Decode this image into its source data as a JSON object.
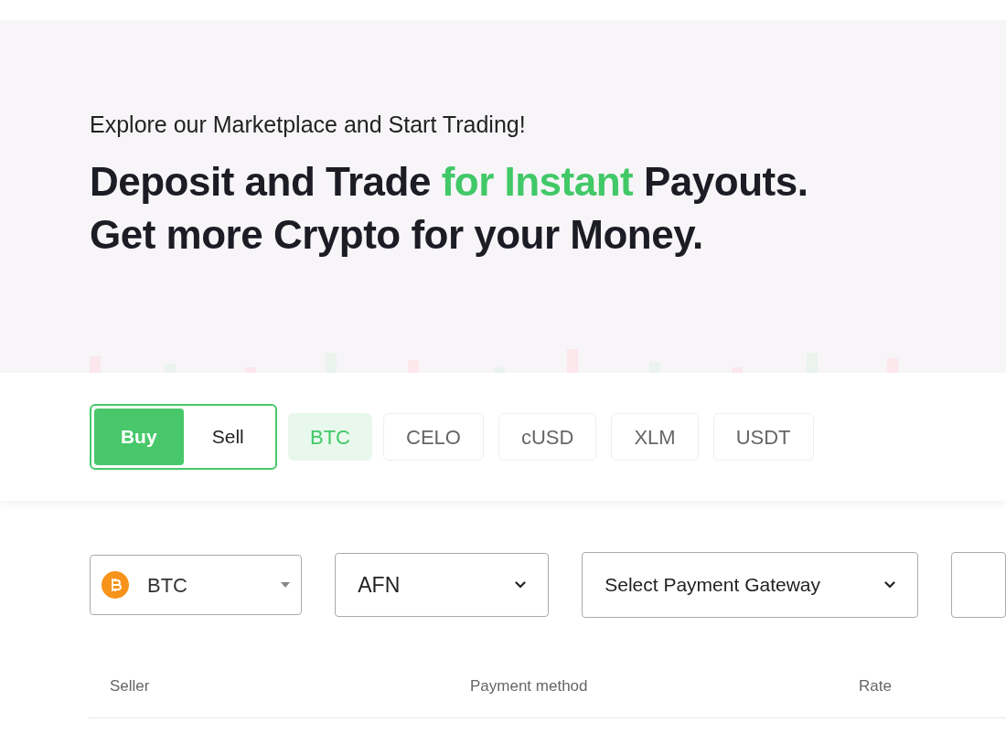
{
  "hero": {
    "eyebrow": "Explore our Marketplace and Start Trading!",
    "headline": "Deposit and Trade ",
    "headline_accent": "for Instant",
    "headline_rest": " Payouts.",
    "subheadline": "Get more Crypto for your Money."
  },
  "trade_toggle": [
    {
      "label": "Buy",
      "selected": true
    },
    {
      "label": "Sell",
      "selected": false
    }
  ],
  "coins": [
    {
      "label": "BTC",
      "selected": true
    },
    {
      "label": "CELO",
      "selected": false
    },
    {
      "label": "cUSD",
      "selected": false
    },
    {
      "label": "XLM",
      "selected": false
    },
    {
      "label": "USDT",
      "selected": false
    }
  ],
  "filters": {
    "coin": {
      "value": "BTC"
    },
    "currency": {
      "value": "AFN"
    },
    "gateway": {
      "value": "Select Payment Gateway"
    }
  },
  "table": {
    "columns": [
      "Seller",
      "Payment method",
      "Rate"
    ]
  }
}
